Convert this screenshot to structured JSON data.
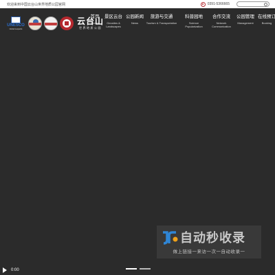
{
  "topbar": {
    "welcome": "欢迎来到中国云台山世界地质公园官网",
    "phone": "0391-5366665",
    "search_placeholder": ""
  },
  "logos": {
    "unesco": "UNESCO",
    "unesco_sub": "Global Geoparks",
    "brand_name": "云台山",
    "brand_sub": "世界地质公园"
  },
  "nav": [
    {
      "cn": "首页",
      "en": "Home"
    },
    {
      "cn": "景区云台",
      "en": "Geosites & Landscapes"
    },
    {
      "cn": "公园新闻",
      "en": "News"
    },
    {
      "cn": "旅游与交通",
      "en": "Tourism & Transportation"
    },
    {
      "cn": "科普园地",
      "en": "Science Popularization"
    },
    {
      "cn": "合作交流",
      "en": "Network Communication"
    },
    {
      "cn": "公园管理",
      "en": "Management"
    },
    {
      "cn": "在线预订",
      "en": "Booking"
    }
  ],
  "watermark": {
    "title": "自动秒收录",
    "subtitle": "做上链接一来访一次一自动收录一"
  },
  "player": {
    "time": "0:00"
  },
  "colors": {
    "background": "#2b2b2b",
    "accent": "#b5282e",
    "nav_text": "#ffffff"
  }
}
